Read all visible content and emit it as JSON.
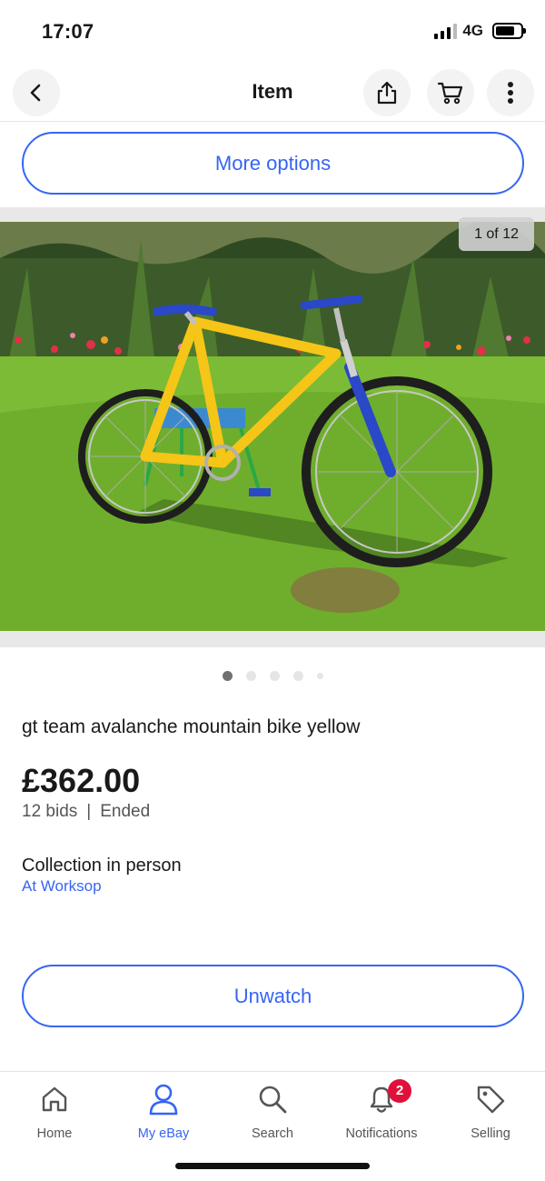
{
  "status_bar": {
    "time": "17:07",
    "network": "4G"
  },
  "nav": {
    "title": "Item"
  },
  "buttons": {
    "more_options": "More options",
    "unwatch": "Unwatch"
  },
  "gallery": {
    "counter": "1 of 12",
    "dots_total": 5,
    "active_dot": 0
  },
  "listing": {
    "title": "gt team avalanche mountain bike yellow",
    "price": "£362.00",
    "bids": "12 bids",
    "separator": "|",
    "status": "Ended",
    "delivery": "Collection in person",
    "location": "At Worksop"
  },
  "tabs": [
    {
      "label": "Home",
      "icon": "home-icon"
    },
    {
      "label": "My eBay",
      "icon": "person-icon",
      "active": true
    },
    {
      "label": "Search",
      "icon": "search-icon"
    },
    {
      "label": "Notifications",
      "icon": "bell-icon",
      "badge": "2"
    },
    {
      "label": "Selling",
      "icon": "tag-icon"
    }
  ],
  "colors": {
    "accent": "#3665f3",
    "badge": "#e0103a",
    "text": "#191919"
  }
}
